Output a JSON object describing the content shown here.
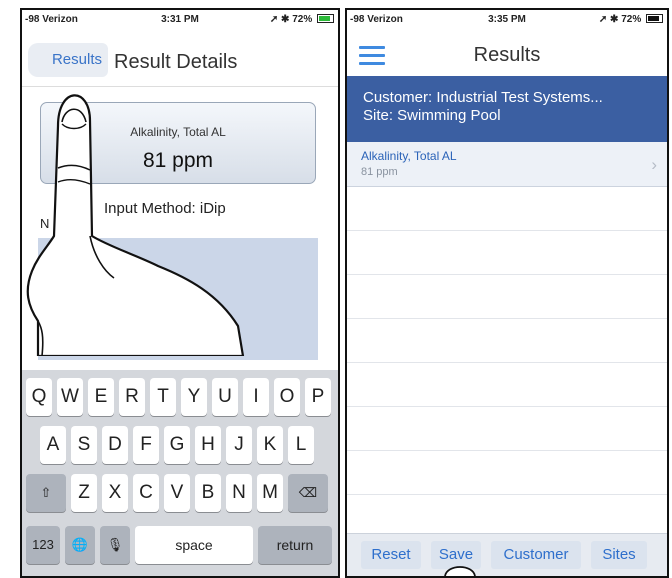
{
  "left_screen": {
    "status": {
      "carrier": "-98 Verizon",
      "time": "3:31 PM",
      "battery": "72%"
    },
    "nav": {
      "back_label": "Results",
      "title": "Result Details"
    },
    "result": {
      "parameter": "Alkalinity, Total AL",
      "value": "81 ppm"
    },
    "input_method": "Input Method: iDip",
    "notes_prefix": "N",
    "keyboard": {
      "row1": [
        "Q",
        "W",
        "E",
        "R",
        "T",
        "Y",
        "U",
        "I",
        "O",
        "P"
      ],
      "row2": [
        "A",
        "S",
        "D",
        "F",
        "G",
        "H",
        "J",
        "K",
        "L"
      ],
      "row3": [
        "Z",
        "X",
        "C",
        "V",
        "B",
        "N",
        "M"
      ],
      "numbers_label": "123",
      "space_label": "space",
      "return_label": "return"
    }
  },
  "right_screen": {
    "status": {
      "carrier": "-98 Verizon",
      "time": "3:35 PM",
      "battery": "72%"
    },
    "title": "Results",
    "customer_line": "Customer: Industrial Test Systems...",
    "site_line": "Site: Swimming Pool",
    "results": [
      {
        "name": "Alkalinity, Total AL",
        "value": "81 ppm"
      }
    ],
    "toolbar": {
      "reset": "Reset",
      "save": "Save",
      "customer": "Customer",
      "sites": "Sites"
    }
  },
  "colors": {
    "accent": "#3a74c8",
    "header_bar": "#3b5fa2",
    "notes_fill": "#cbd6e8",
    "keyboard_bg": "#d4d7dc"
  }
}
